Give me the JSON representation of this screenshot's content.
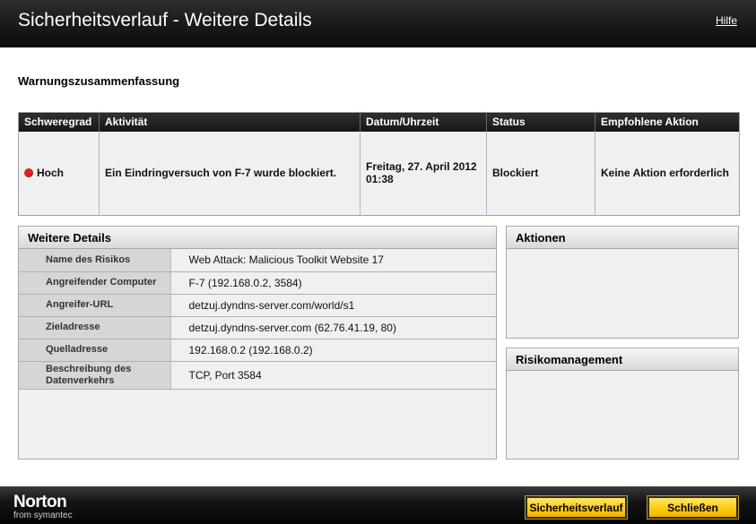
{
  "header": {
    "title": "Sicherheitsverlauf - Weitere Details",
    "help_link": "Hilfe"
  },
  "summary_title": "Warnungszusammenfassung",
  "summary_table": {
    "columns": [
      "Schweregrad",
      "Aktivität",
      "Datum/Uhrzeit",
      "Status",
      "Empfohlene Aktion"
    ],
    "row": {
      "severity": "Hoch",
      "severity_color": "#e02020",
      "activity": "Ein Eindringversuch von F-7 wurde blockiert.",
      "datetime": "Freitag, 27. April 2012 01:38",
      "status": "Blockiert",
      "recommended_action": "Keine Aktion erforderlich"
    }
  },
  "details_panel": {
    "title": "Weitere Details",
    "rows": [
      {
        "label": "Name des Risikos",
        "value": "Web Attack: Malicious Toolkit Website 17"
      },
      {
        "label": "Angreifender Computer",
        "value": "F-7 (192.168.0.2, 3584)"
      },
      {
        "label": "Angreifer-URL",
        "value": "detzuj.dyndns-server.com/world/s1"
      },
      {
        "label": "Zieladresse",
        "value": "detzuj.dyndns-server.com (62.76.41.19, 80)"
      },
      {
        "label": "Quelladresse",
        "value": "192.168.0.2 (192.168.0.2)"
      },
      {
        "label": "Beschreibung des Datenverkehrs",
        "value": "TCP, Port 3584"
      }
    ]
  },
  "actions_panel": {
    "title": "Aktionen"
  },
  "risk_panel": {
    "title": "Risikomanagement"
  },
  "footer": {
    "brand": "Norton",
    "brand_sub": "from symantec",
    "history_button": "Sicherheitsverlauf",
    "close_button": "Schließen"
  }
}
